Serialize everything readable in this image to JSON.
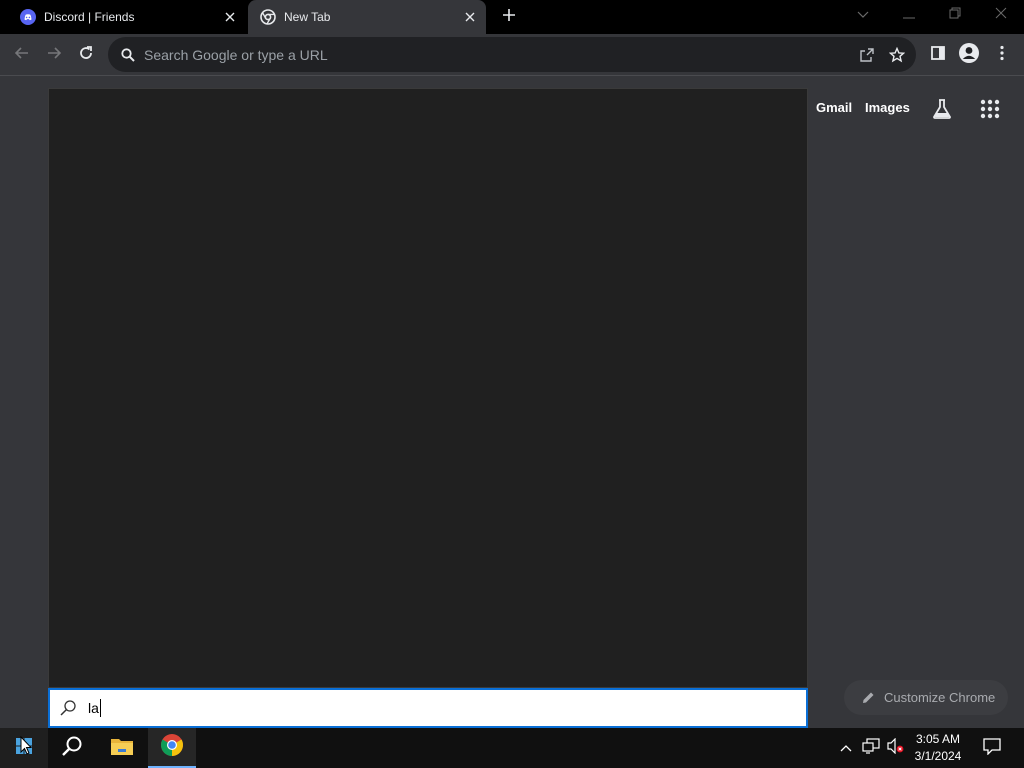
{
  "tabs": [
    {
      "label": "Discord | Friends",
      "active": false,
      "favicon": "discord-icon"
    },
    {
      "label": "New Tab",
      "active": true,
      "favicon": "chrome-icon"
    }
  ],
  "omnibox": {
    "placeholder": "Search Google or type a URL"
  },
  "newtab": {
    "gmail_label": "Gmail",
    "images_label": "Images",
    "customize_label": "Customize Chrome"
  },
  "search": {
    "query": "la"
  },
  "taskbar": {
    "time": "3:05 AM",
    "date": "3/1/2024"
  },
  "colors": {
    "tabstrip": "#000000",
    "toolbar": "#35363a",
    "omnibox": "#202124",
    "flyout": "#202020",
    "search_border": "#0a6fd6",
    "taskbar": "#101010",
    "discord_brand": "#5865f2"
  }
}
